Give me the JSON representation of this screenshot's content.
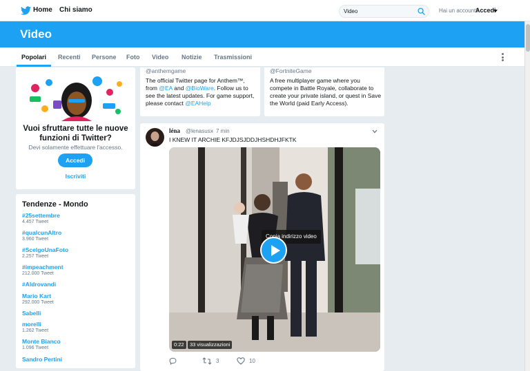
{
  "nav": {
    "home_label": "Home",
    "about_label": "Chi siamo",
    "search_value": "Video",
    "account_question": "Hai un account?",
    "login_label": "Accedi"
  },
  "header": {
    "title": "Video"
  },
  "tabs": [
    {
      "label": "Popolari",
      "active": true
    },
    {
      "label": "Recenti",
      "active": false
    },
    {
      "label": "Persone",
      "active": false
    },
    {
      "label": "Foto",
      "active": false
    },
    {
      "label": "Video",
      "active": false
    },
    {
      "label": "Notizie",
      "active": false
    },
    {
      "label": "Trasmissioni",
      "active": false
    }
  ],
  "signup": {
    "title": "Vuoi sfruttare tutte le nuove funzioni di Twitter?",
    "subtitle": "Devi solamente effettuare l'accesso.",
    "login_button": "Accedi",
    "signup_link": "Iscriviti"
  },
  "trends": {
    "title": "Tendenze - Mondo",
    "items": [
      {
        "name": "#25settembre",
        "count": "4.457 Tweet"
      },
      {
        "name": "#qualcunAltro",
        "count": "3.960 Tweet"
      },
      {
        "name": "#ScelgoUnaFoto",
        "count": "2.257 Tweet"
      },
      {
        "name": "#impeachment",
        "count": "212.000 Tweet"
      },
      {
        "name": "#Aldrovandi",
        "count": ""
      },
      {
        "name": "Mario Kart",
        "count": "292.000 Tweet"
      },
      {
        "name": "Sabelli",
        "count": ""
      },
      {
        "name": "morelli",
        "count": "1.262 Tweet"
      },
      {
        "name": "Monte Bianco",
        "count": "1.096 Tweet"
      },
      {
        "name": "Sandro Pertini",
        "count": ""
      }
    ]
  },
  "profiles": [
    {
      "handle": "@anthemgame",
      "bio_parts": [
        "The official Twitter page for Anthem™, from ",
        "@EA",
        " and ",
        "@BioWare",
        ". Follow us to see the latest updates. For game support, please contact ",
        "@EAHelp"
      ]
    },
    {
      "handle": "@FortniteGame",
      "bio": "A free multiplayer game where you compete in Battle Royale, collaborate to create your private island, or quest in Save the World (paid Early Access)."
    }
  ],
  "tweet": {
    "name": "léna",
    "handle": "@lenasusx",
    "separator": "·",
    "time": "7 min",
    "text": "I KNEW IT ARCHIE KFJDJSJDDJHSHDHJFKTK",
    "tooltip": "Copia indirizzo video",
    "duration": "0:22",
    "views": "33 visualizzazioni",
    "retweets": "3",
    "likes": "10"
  },
  "colors": {
    "accent": "#1da1f2",
    "background": "#e6ecf0",
    "text_secondary": "#657786"
  }
}
